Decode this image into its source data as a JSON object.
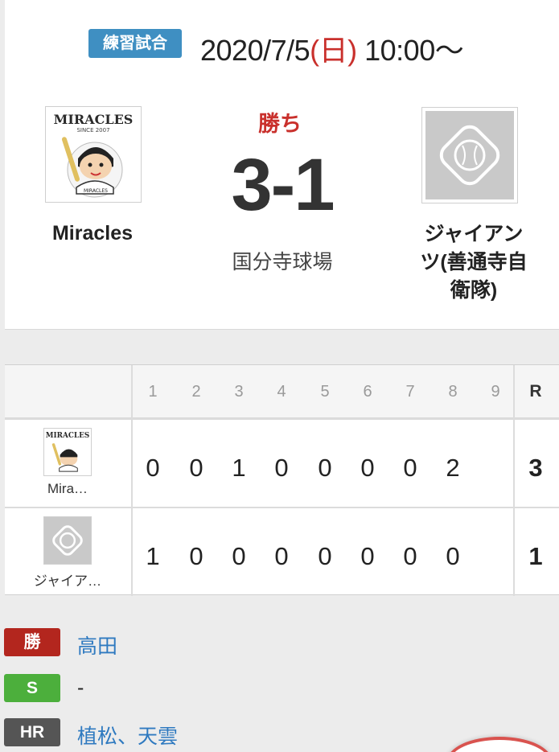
{
  "game": {
    "type_badge": "練習試合",
    "date": "2020/7/5",
    "dow": "(日)",
    "time": "10:00〜",
    "result": "勝ち",
    "score": "3-1",
    "venue": "国分寺球場"
  },
  "home": {
    "name": "Miracles",
    "logo_text": "MIRACLES",
    "logo_sub": "SINCE 2007",
    "short_name": "Mira…",
    "innings": [
      "0",
      "0",
      "1",
      "0",
      "0",
      "0",
      "0",
      "2",
      ""
    ],
    "runs": "3"
  },
  "away": {
    "name_lines": [
      "ジャイアン",
      "ツ(善通寺自",
      "衛隊)"
    ],
    "short_name": "ジャイア…",
    "innings": [
      "1",
      "0",
      "0",
      "0",
      "0",
      "0",
      "0",
      "0",
      ""
    ],
    "runs": "1"
  },
  "scoreboard": {
    "inning_labels": [
      "1",
      "2",
      "3",
      "4",
      "5",
      "6",
      "7",
      "8",
      "9"
    ],
    "runs_label": "R"
  },
  "pitchers": {
    "win_label": "勝",
    "win": "高田",
    "save_label": "S",
    "save": "-",
    "hr_label": "HR",
    "hr": "植松、天雲"
  },
  "colors": {
    "accent_red": "#c9302c",
    "type_badge_blue": "#3f8fc2",
    "link_blue": "#2f7ac0",
    "win_badge": "#b3261e",
    "save_badge": "#4caf3c",
    "hr_badge": "#555555"
  }
}
